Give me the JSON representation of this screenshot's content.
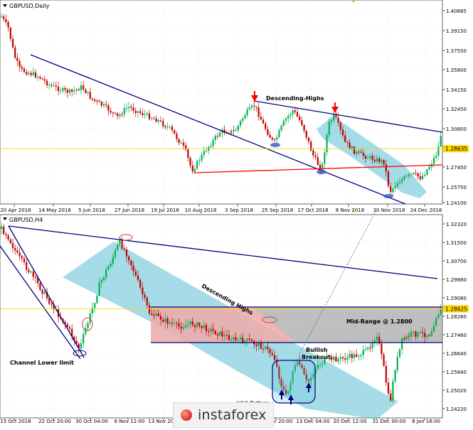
{
  "chart_data": [
    {
      "type": "candlestick",
      "title": "GBPUSD,Daily",
      "y_ticks": [
        "1.40885",
        "1.39150",
        "1.37550",
        "1.35800",
        "1.34150",
        "1.32450",
        "1.30800",
        "1.29100",
        "1.27450",
        "1.25750",
        "1.24100"
      ],
      "ylim": [
        1.2395,
        1.4126
      ],
      "x_ticks": [
        "20 Apr 2018",
        "14 May 2018",
        "5 Jun 2018",
        "27 Jun 2018",
        "19 Jul 2018",
        "10 Aug 2018",
        "3 Sep 2018",
        "25 Sep 2018",
        "17 Oct 2018",
        "8 Nov 2018",
        "30 Nov 2018",
        "24 Dec 2018"
      ],
      "price_label": "1.28635",
      "current_price": 1.2864,
      "annotations": [
        "Descending-Highs"
      ],
      "grid": true,
      "colors": {
        "up": "#00b050",
        "down": "#c00000",
        "trend": "#000080",
        "support": "#ff0000",
        "price_line": "#ffd700",
        "channel": "#5cc0d3"
      }
    },
    {
      "type": "candlestick",
      "title": "GBPUSD,H4",
      "y_ticks": [
        "1.32320",
        "1.31500",
        "1.30700",
        "1.29880",
        "1.29080",
        "1.28260",
        "1.27460",
        "1.26640",
        "1.25840",
        "1.25020",
        "1.24220"
      ],
      "ylim": [
        1.2397,
        1.3263
      ],
      "x_ticks": [
        "15 Oct 2018",
        "22 Oct 20:00",
        "30 Oct 04:00",
        "6 Nov 12:00",
        "13 Nov 20:00",
        "21 Nov 04:00",
        "28 Nov 12:00",
        "5 Dec 20:00",
        "13 Dec 04:00",
        "20 Dec 12:00",
        "31 Dec 00:00",
        "8 Jan 16:00"
      ],
      "price_label": "1.28625",
      "current_price": 1.2862,
      "annotations": [
        "Descending Highs",
        "Mid-Range @ 1.2800",
        "Bullish",
        "Breakout",
        "Channel Lower limit",
        "H&S Pattern"
      ],
      "grid": true,
      "colors": {
        "up": "#00b050",
        "down": "#c00000",
        "trend": "#000080",
        "range_top": "#ffb3b3",
        "range": "#808080",
        "channel": "#5cc0d3",
        "price_line": "#ffd700"
      }
    }
  ],
  "watermark": "instaforex"
}
